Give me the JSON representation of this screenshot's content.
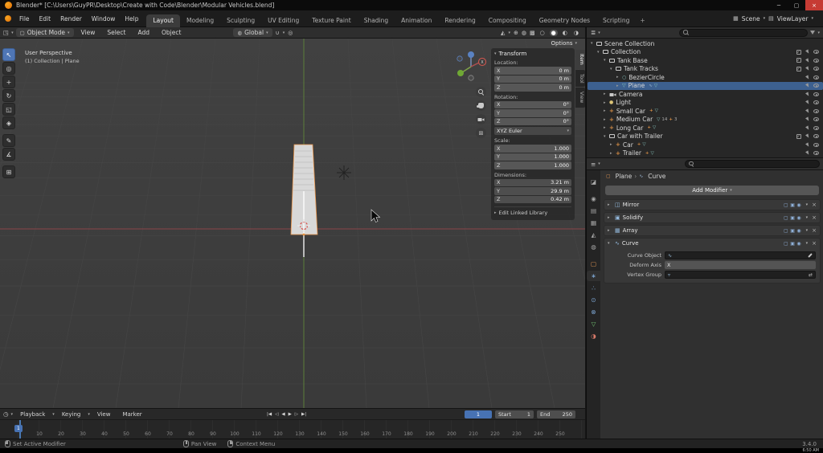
{
  "colors": {
    "accent": "#4772b3",
    "selection": "#3d608f",
    "object_orange": "#e8913d",
    "axis_x_red": "#8b4449",
    "axis_y_green": "#5c7d3a"
  },
  "titlebar": {
    "app_title": "Blender* [C:\\Users\\GuyPR\\Desktop\\Create with Code\\Blender\\Modular Vehicles.blend]"
  },
  "topbar": {
    "menus": [
      "File",
      "Edit",
      "Render",
      "Window",
      "Help"
    ],
    "workspaces": [
      "Layout",
      "Modeling",
      "Sculpting",
      "UV Editing",
      "Texture Paint",
      "Shading",
      "Animation",
      "Rendering",
      "Compositing",
      "Geometry Nodes",
      "Scripting"
    ],
    "add_workspace": "+",
    "scene_label": "Scene",
    "view_layer_label": "ViewLayer"
  },
  "vp_header": {
    "mode": "Object Mode",
    "menus": [
      "View",
      "Select",
      "Add",
      "Object"
    ],
    "orientation": "Global",
    "options_label": "Options"
  },
  "viewport": {
    "view_name": "User Perspective",
    "context_info": "(1) Collection | Plane",
    "gizmo_x_label": "X",
    "sidebar_tabs": [
      "Item",
      "Tool",
      "View"
    ],
    "active_sidebar_tab": "Item"
  },
  "npanel": {
    "title": "Transform",
    "location_label": "Location:",
    "rotation_label": "Rotation:",
    "scale_label": "Scale:",
    "dimensions_label": "Dimensions:",
    "axes": [
      "X",
      "Y",
      "Z"
    ],
    "location": {
      "x": "0 m",
      "y": "0 m",
      "z": "0 m"
    },
    "rotation": {
      "x": "0°",
      "y": "0°",
      "z": "0°"
    },
    "rotation_mode": "XYZ Euler",
    "scale": {
      "x": "1.000",
      "y": "1.000",
      "z": "1.000"
    },
    "dimensions": {
      "x": "3.21 m",
      "y": "29.9 m",
      "z": "0.42 m"
    },
    "edit_linked_label": "Edit Linked Library"
  },
  "outliner": {
    "rows": [
      {
        "label": "Scene Collection",
        "arrow": "▾"
      },
      {
        "label": "Collection",
        "arrow": "▾"
      },
      {
        "label": "Tank Base",
        "arrow": "▾"
      },
      {
        "label": "Tank Tracks",
        "arrow": "▾"
      },
      {
        "label": "BezierCircle",
        "arrow": "▸"
      },
      {
        "label": "Plane",
        "arrow": "▸"
      },
      {
        "label": "Camera",
        "arrow": "▸"
      },
      {
        "label": "Light",
        "arrow": "▸"
      },
      {
        "label": "Small Car",
        "arrow": "▸"
      },
      {
        "label": "Medium Car",
        "arrow": "▸",
        "counts": [
          "14",
          "3"
        ]
      },
      {
        "label": "Long Car",
        "arrow": "▸"
      },
      {
        "label": "Car with Trailer",
        "arrow": "▾"
      },
      {
        "label": "Car",
        "arrow": "▸"
      },
      {
        "label": "Trailer",
        "arrow": "▸"
      }
    ]
  },
  "properties": {
    "breadcrumb_object": "Plane",
    "breadcrumb_data": "Curve",
    "add_modifier_label": "Add Modifier",
    "modifiers": [
      {
        "name": "Mirror"
      },
      {
        "name": "Solidify"
      },
      {
        "name": "Array"
      },
      {
        "name": "Curve"
      }
    ],
    "curve_modifier": {
      "curve_object_label": "Curve Object",
      "curve_object_value": "",
      "deform_axis_label": "Deform Axis",
      "deform_axis_value": "X",
      "vertex_group_label": "Vertex Group",
      "vertex_group_value": ""
    }
  },
  "timeline": {
    "menus": [
      "Playback",
      "Keying",
      "View",
      "Marker"
    ],
    "current_frame": "1",
    "start_label": "Start",
    "start_value": "1",
    "end_label": "End",
    "end_value": "250",
    "ticks": [
      "10",
      "20",
      "30",
      "40",
      "50",
      "60",
      "70",
      "80",
      "90",
      "100",
      "110",
      "120",
      "130",
      "140",
      "150",
      "160",
      "170",
      "180",
      "190",
      "200",
      "210",
      "220",
      "230",
      "240",
      "250"
    ]
  },
  "status_bar": {
    "hints": [
      "Set Active Modifier",
      "Pan View",
      "Context Menu"
    ],
    "version": "3.4.0"
  },
  "taskbar": {
    "time": "6:50 AM"
  }
}
